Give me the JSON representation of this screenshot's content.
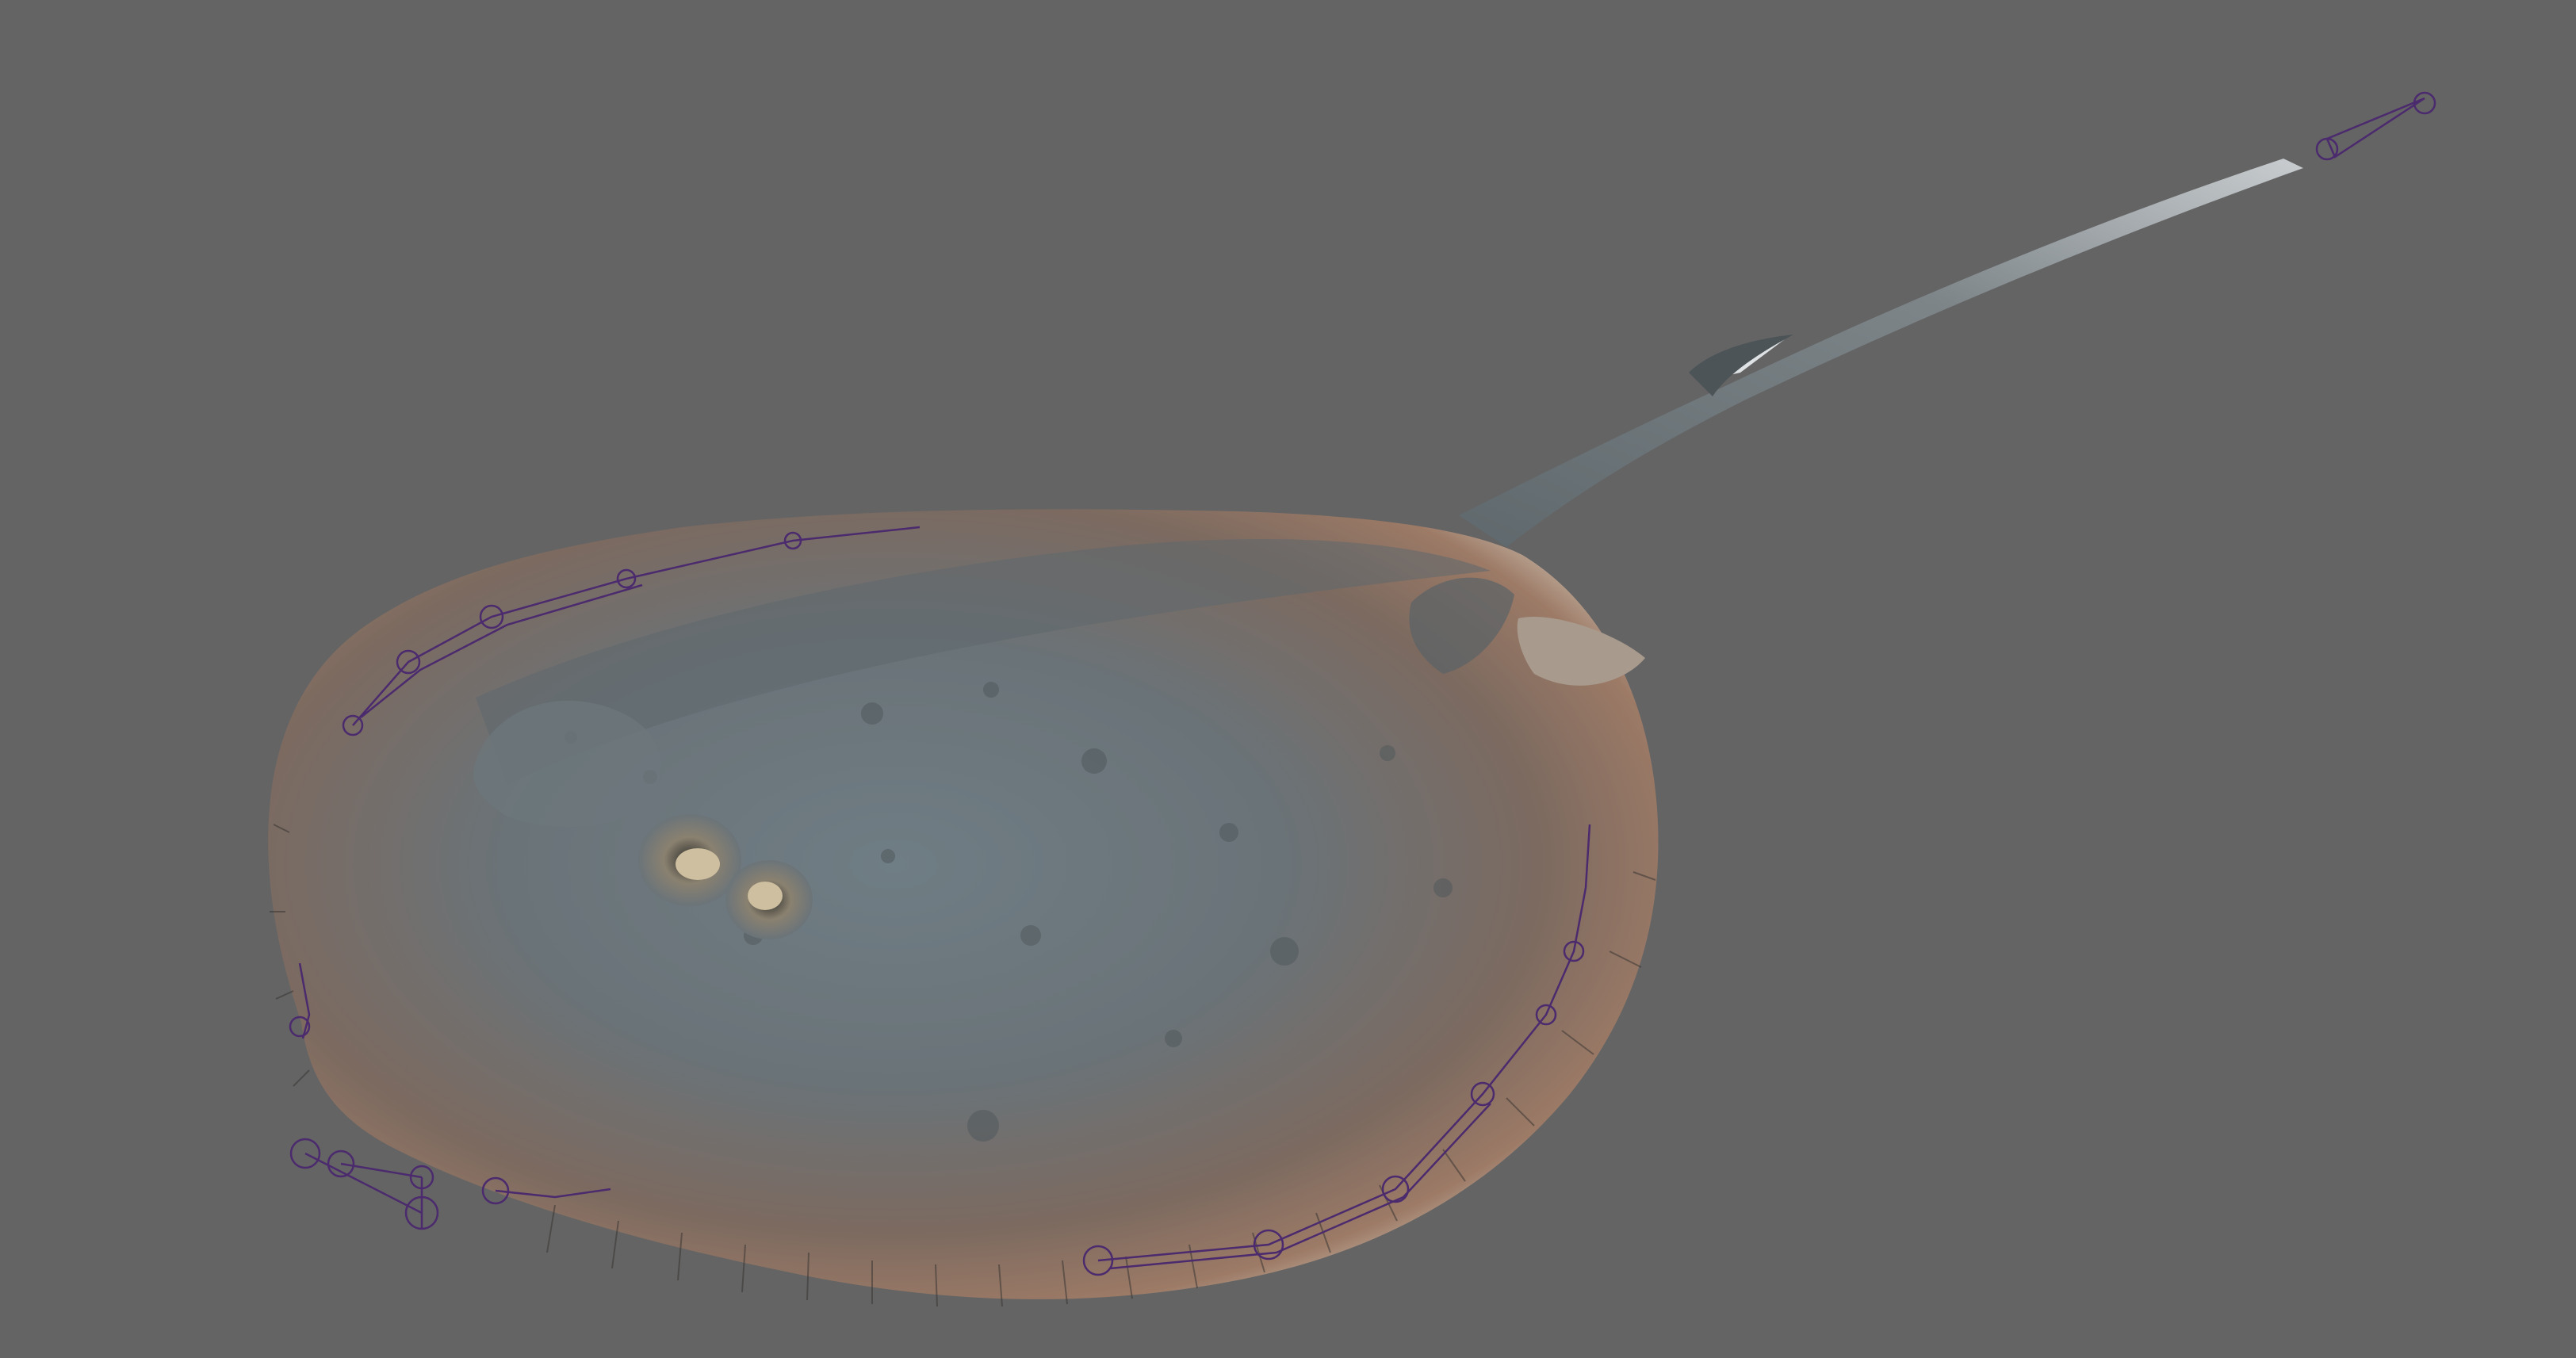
{
  "viewport": {
    "background_color": "#646464",
    "subject": "stingray-model",
    "rig_color": "#4b2a6e",
    "body_colors": {
      "center": "#6c7a80",
      "rim": "#8a6a57",
      "highlight": "#c9b8a8",
      "tail": "#7a8286"
    }
  }
}
